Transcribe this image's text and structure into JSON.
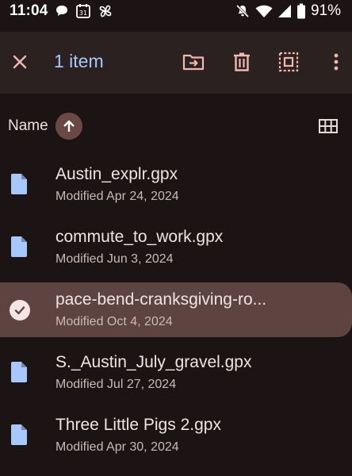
{
  "status_bar": {
    "time": "11:04",
    "calendar_day": "31",
    "battery_percent": "91%",
    "icons_left": [
      "chat-bubble-icon",
      "calendar-icon",
      "fan-icon"
    ],
    "icons_right": [
      "do-not-disturb-off-icon",
      "wifi-icon",
      "cell-signal-icon",
      "battery-icon"
    ]
  },
  "action_bar": {
    "selection_label": "1 item",
    "close_icon": "close-icon",
    "actions": [
      "move-to-folder-icon",
      "delete-icon",
      "select-all-icon",
      "more-vert-icon"
    ],
    "accent_color": "#a8c7fa",
    "action_icon_color": "#f2b8b0"
  },
  "sort": {
    "label": "Name",
    "direction": "ascending",
    "view_toggle_icon": "grid-view-icon"
  },
  "files": [
    {
      "name": "Austin_explr.gpx",
      "meta": "Modified Apr 24, 2024",
      "selected": false
    },
    {
      "name": "commute_to_work.gpx",
      "meta": "Modified Jun 3, 2024",
      "selected": false
    },
    {
      "name": "pace-bend-cranksgiving-ro...",
      "meta": "Modified Oct 4, 2024",
      "selected": true
    },
    {
      "name": "S._Austin_July_gravel.gpx",
      "meta": "Modified Jul 27, 2024",
      "selected": false
    },
    {
      "name": "Three Little Pigs 2.gpx",
      "meta": "Modified Apr 30, 2024",
      "selected": false
    }
  ],
  "colors": {
    "background": "#1c1414",
    "toolbar": "#2b2120",
    "selected_row": "#5e4440",
    "file_icon": "#a8c7fa"
  }
}
